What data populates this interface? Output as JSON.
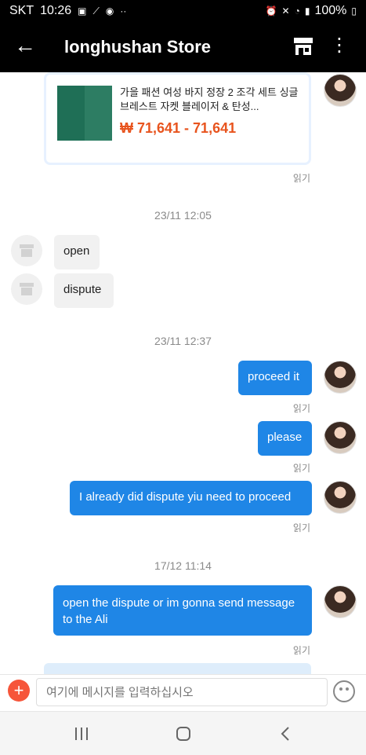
{
  "statusbar": {
    "carrier": "SKT",
    "time": "10:26",
    "battery": "100%"
  },
  "header": {
    "title": "longhushan Store"
  },
  "product": {
    "title": "가을 패션 여성 바지 정장 2 조각 세트 싱글 브레스트 자켓 블레이저 & 탄성...",
    "price": "₩ 71,641 - 71,641",
    "read": "읽기"
  },
  "messages": [
    {
      "timestamp": "23/11 12:05"
    },
    {
      "text": "open"
    },
    {
      "text": "dispute"
    },
    {
      "timestamp": "23/11 12:37"
    },
    {
      "text": "proceed it",
      "read": "읽기"
    },
    {
      "text": "please",
      "read": "읽기"
    },
    {
      "text": "I already did dispute yiu need to proceed",
      "read": "읽기"
    },
    {
      "timestamp": "17/12 11:14"
    },
    {
      "text": "open the dispute or im gonna send message to the Ali",
      "read": "읽기"
    }
  ],
  "composer": {
    "placeholder": "여기에 메시지를 입력하십시오"
  },
  "colors": {
    "accent_blue": "#1f86e6",
    "price_orange": "#e8541e",
    "add_button_red": "#f6553a",
    "header_black": "#000000"
  }
}
